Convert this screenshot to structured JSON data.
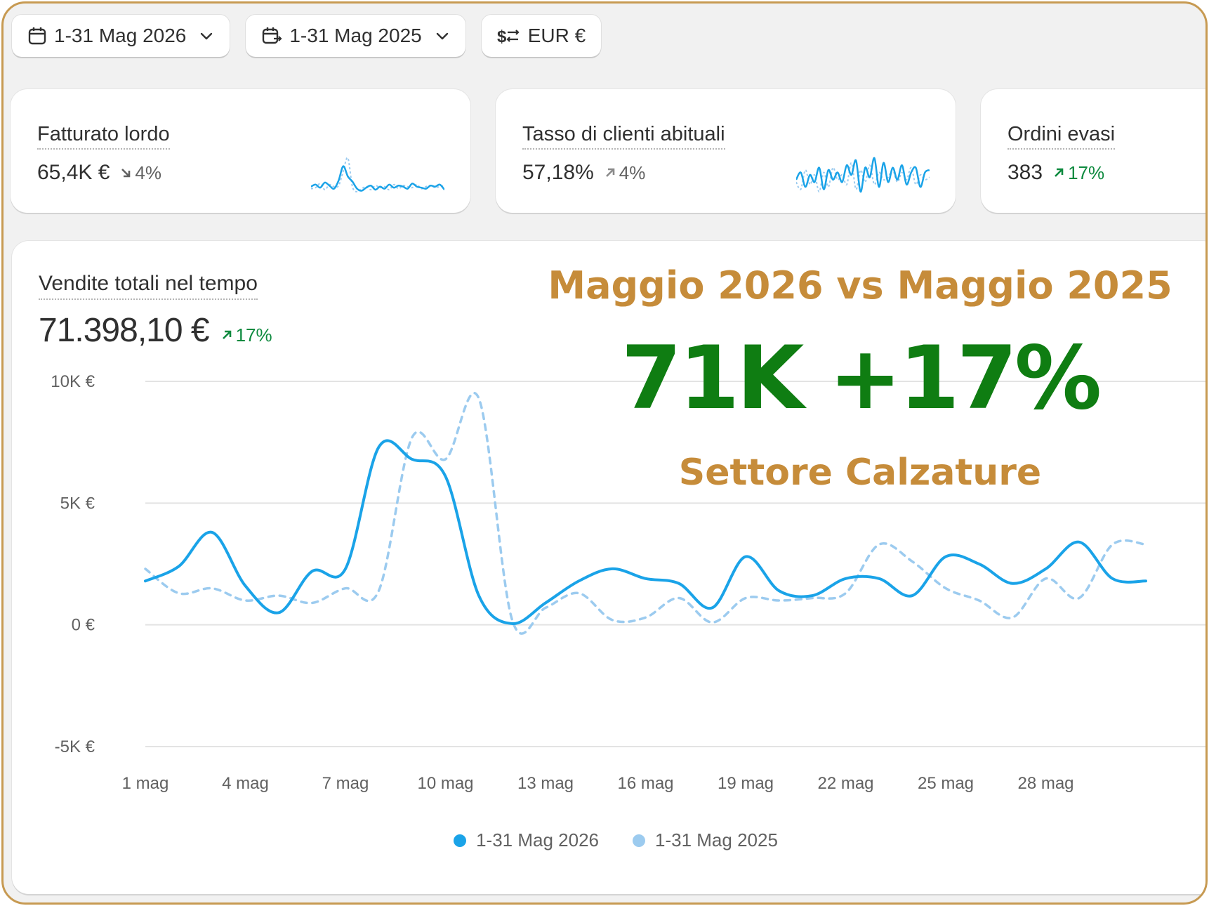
{
  "toolbar": {
    "date_range": "1-31 Mag 2026",
    "compare_range": "1-31 Mag 2025",
    "currency": "EUR €"
  },
  "metrics": [
    {
      "label": "Fatturato lordo",
      "value": "65,4K €",
      "delta": "4%",
      "direction": "down",
      "delta_color": "#616161"
    },
    {
      "label": "Tasso di clienti abituali",
      "value": "57,18%",
      "delta": "4%",
      "direction": "up",
      "delta_color": "#616161"
    },
    {
      "label": "Ordini evasi",
      "value": "383",
      "delta": "17%",
      "direction": "up",
      "delta_color": "#0e8a3f"
    }
  ],
  "main": {
    "title": "Vendite totali nel tempo",
    "total": "71.398,10 €",
    "delta": "17%"
  },
  "overlay": {
    "line1": "Maggio 2026 vs Maggio 2025",
    "line2": "71K +17%",
    "line3": "Settore Calzature"
  },
  "colors": {
    "series_current": "#1aa3e8",
    "series_previous": "#9ccbef",
    "positive": "#0e8a3f",
    "brand_gold": "#c68c3a",
    "headline_green": "#0f7d12"
  },
  "chart_data": {
    "type": "line",
    "y_ticks": [
      "10K €",
      "5K €",
      "0 €",
      "-5K €"
    ],
    "x_tick_labels": [
      "1 mag",
      "4 mag",
      "7 mag",
      "10 mag",
      "13 mag",
      "16 mag",
      "19 mag",
      "22 mag",
      "25 mag",
      "28 mag"
    ],
    "ylim": [
      -5000,
      10000
    ],
    "x": [
      1,
      2,
      3,
      4,
      5,
      6,
      7,
      8,
      9,
      10,
      11,
      12,
      13,
      14,
      15,
      16,
      17,
      18,
      19,
      20,
      21,
      22,
      23,
      24,
      25,
      26,
      27,
      28,
      29,
      30,
      31
    ],
    "series": [
      {
        "name": "1-31 Mag 2026",
        "values": [
          1800,
          2400,
          3800,
          1600,
          500,
          2200,
          2300,
          7300,
          6800,
          6100,
          1200,
          50,
          900,
          1800,
          2300,
          1900,
          1700,
          700,
          2800,
          1400,
          1200,
          1900,
          1900,
          1200,
          2800,
          2500,
          1700,
          2300,
          3400,
          1900,
          1800
        ]
      },
      {
        "name": "1-31 Mag 2025",
        "values": [
          2300,
          1300,
          1500,
          1000,
          1200,
          900,
          1500,
          1400,
          7700,
          6800,
          9300,
          200,
          700,
          1300,
          200,
          300,
          1100,
          100,
          1100,
          1000,
          1100,
          1300,
          3300,
          2600,
          1500,
          1000,
          300,
          1900,
          1100,
          3300,
          3300
        ]
      }
    ],
    "legend": [
      "1-31 Mag 2026",
      "1-31 Mag 2025"
    ],
    "grid": true,
    "legend_position": "bottom"
  },
  "sparklines": {
    "gross": {
      "current": [
        20,
        22,
        19,
        24,
        21,
        18,
        26,
        40,
        30,
        25,
        18,
        16,
        19,
        21,
        17,
        20,
        18,
        22,
        19,
        21,
        20,
        18,
        23,
        20,
        19,
        18,
        21,
        20,
        22,
        17
      ],
      "previous": [
        18,
        19,
        23,
        17,
        22,
        20,
        21,
        35,
        48,
        20,
        15,
        18,
        20,
        17,
        21,
        19,
        20,
        17,
        22,
        18,
        21,
        20,
        19,
        22,
        18,
        20,
        21,
        19,
        20,
        21
      ]
    },
    "returning": {
      "current": [
        30,
        36,
        24,
        34,
        28,
        40,
        22,
        38,
        30,
        36,
        28,
        42,
        34,
        46,
        20,
        40,
        32,
        48,
        24,
        44,
        28,
        40,
        30,
        42,
        26,
        36,
        40,
        24,
        36,
        38
      ],
      "previous": [
        28,
        22,
        38,
        26,
        34,
        20,
        36,
        24,
        40,
        30,
        34,
        26,
        44,
        22,
        38,
        28,
        42,
        26,
        36,
        30,
        32,
        38,
        28,
        36,
        30,
        40,
        26,
        34,
        30,
        32
      ]
    }
  }
}
